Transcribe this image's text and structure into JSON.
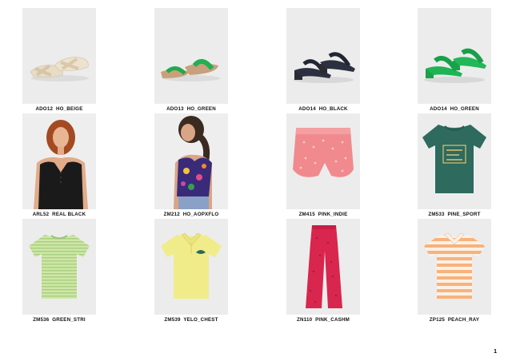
{
  "products": [
    {
      "code": "ADO12  HO_BEIGE",
      "image": "beige-crossed-sandals"
    },
    {
      "code": "ADO13  HO_GREEN",
      "image": "green-strap-sliders"
    },
    {
      "code": "ADO14  HO_BLACK",
      "image": "black-heeled-sandals"
    },
    {
      "code": "ADO14  HO_GREEN",
      "image": "green-heeled-sandals"
    },
    {
      "code": "ARL52  REAL BLACK",
      "image": "black-ribbed-top-model"
    },
    {
      "code": "ZM212  HO_AOPXFLO",
      "image": "floral-top-model"
    },
    {
      "code": "ZM415  PINK_INDIE",
      "image": "pink-printed-shorts"
    },
    {
      "code": "ZM533  PINE_SPORT",
      "image": "green-graphic-tshirt"
    },
    {
      "code": "ZM536  GREEN_STRI",
      "image": "green-striped-tshirt"
    },
    {
      "code": "ZM539  YELO_CHEST",
      "image": "yellow-polo-shirt"
    },
    {
      "code": "ZN110  PINK_CASHM",
      "image": "pink-flared-trousers"
    },
    {
      "code": "ZP125  PEACH_RAY",
      "image": "peach-striped-polo"
    }
  ],
  "page": {
    "number": "1"
  }
}
